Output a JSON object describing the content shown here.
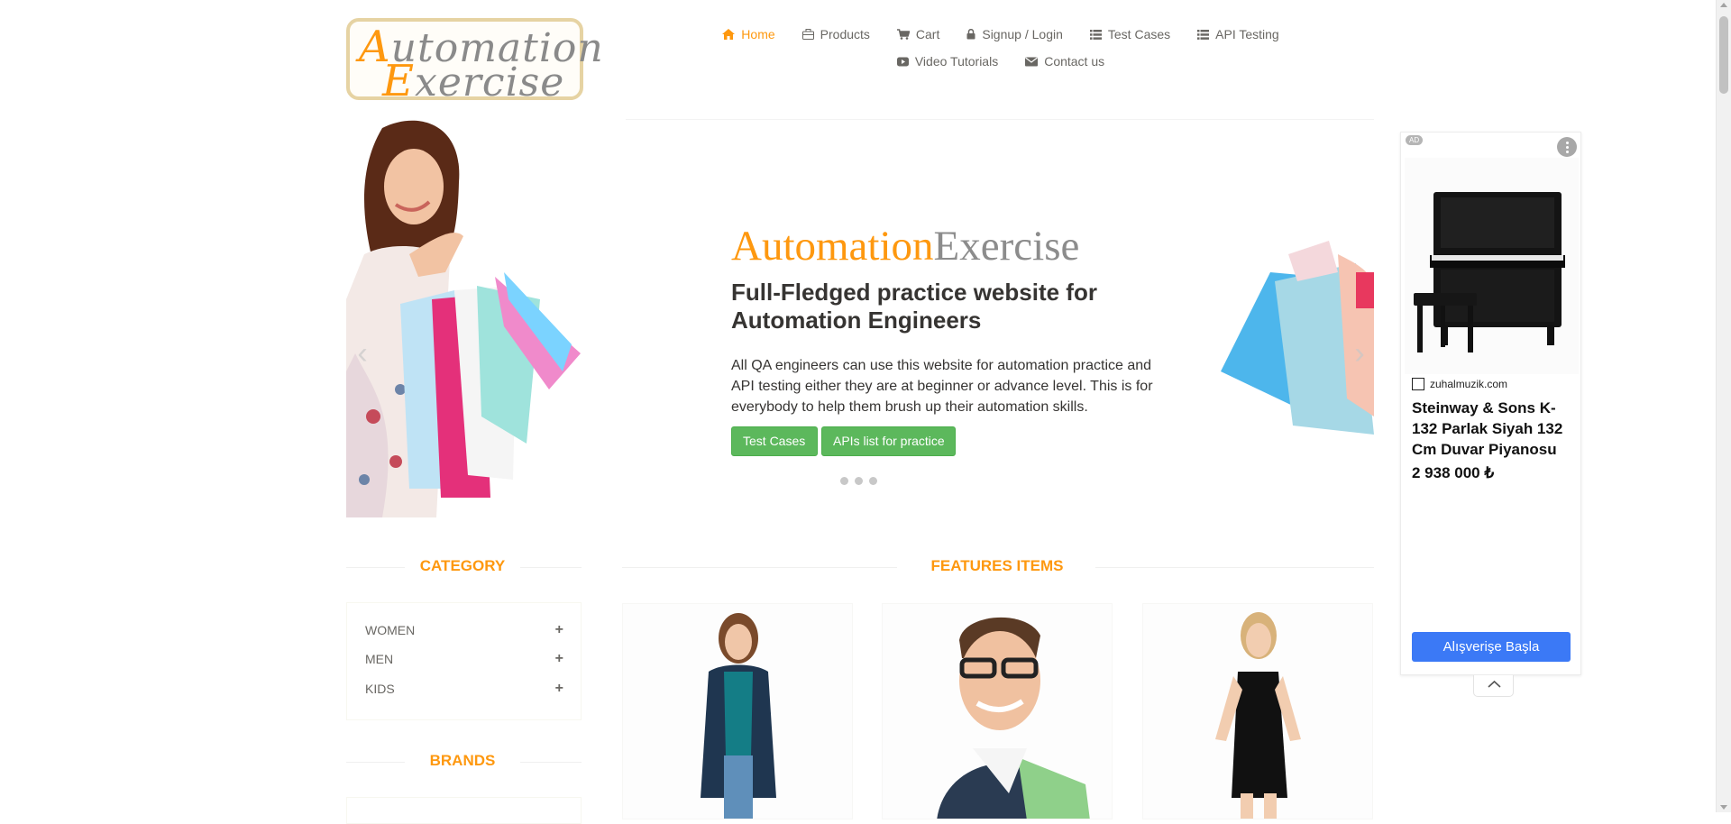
{
  "logo": {
    "line1_cap": "A",
    "line1_rest": "utomation",
    "line2_cap": "E",
    "line2_rest": "xercise"
  },
  "nav": {
    "row1": [
      {
        "label": "Home",
        "icon": "home-icon",
        "active": true
      },
      {
        "label": "Products",
        "icon": "briefcase-icon"
      },
      {
        "label": "Cart",
        "icon": "cart-icon"
      },
      {
        "label": "Signup / Login",
        "icon": "lock-icon"
      },
      {
        "label": "Test Cases",
        "icon": "list-icon"
      },
      {
        "label": "API Testing",
        "icon": "list-icon"
      }
    ],
    "row2": [
      {
        "label": "Video Tutorials",
        "icon": "youtube-play-icon"
      },
      {
        "label": "Contact us",
        "icon": "envelope-icon"
      }
    ]
  },
  "hero": {
    "brand_a": "Automation",
    "brand_b": "Exercise",
    "title": "Full-Fledged practice website for Automation Engineers",
    "text": "All QA engineers can use this website for automation practice and API testing either they are at beginner or advance level. This is for everybody to help them brush up their automation skills.",
    "button1": "Test Cases",
    "button2": "APIs list for practice",
    "dots": 3
  },
  "sections": {
    "category": "CATEGORY",
    "features": "FEATURES ITEMS",
    "brands": "BRANDS"
  },
  "categories": [
    "WOMEN",
    "MEN",
    "KIDS"
  ],
  "ad": {
    "badge": "AD",
    "domain": "zuhalmuzik.com",
    "title": "Steinway & Sons K-132 Parlak Siyah 132 Cm Duvar Piyanosu",
    "price": "2 938 000 ₺",
    "cta": "Alışverişe Başla"
  },
  "colors": {
    "accent": "#fe980f",
    "button_green": "#5cb85c",
    "ad_cta": "#3b79f6",
    "text": "#696763"
  }
}
